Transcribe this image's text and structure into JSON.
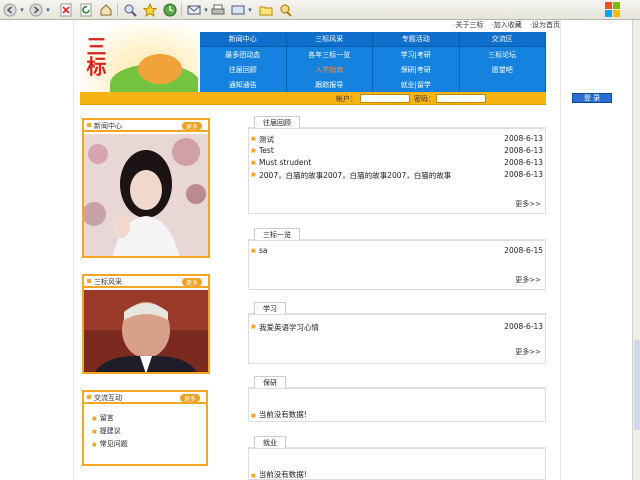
{
  "toolbar": {
    "buttons": [
      "back-icon",
      "forward-icon",
      "stop-icon",
      "refresh-icon",
      "home-icon",
      "search-icon",
      "favorites-icon",
      "history-icon",
      "mail-icon",
      "print-icon",
      "edit-icon",
      "folder-icon",
      "messenger-icon"
    ]
  },
  "top_links": [
    "关于三标",
    "加入收藏",
    "设为首页"
  ],
  "logo": {
    "text": "三标"
  },
  "nav": [
    [
      "新闻中心",
      "三标风采",
      "专题活动",
      "交流区"
    ],
    [
      "最多团动态",
      "各年三标一览",
      "学习|考研",
      "三标论坛"
    ],
    [
      "往届回顾",
      "入学指南",
      "保研|考研",
      "愿望吧"
    ],
    [
      "通知通告",
      "跟踪报导",
      "就业|留学",
      ""
    ]
  ],
  "nav_highlight": "入学指南",
  "login": {
    "account_label": "帐户：",
    "password_label": "密码：",
    "submit": "登 录"
  },
  "sidebar": {
    "news": {
      "title": "新闻中心",
      "more": "更多"
    },
    "style": {
      "title": "三标风采",
      "more": "更多"
    },
    "exchange": {
      "title": "交流互动",
      "more": "更多",
      "items": [
        "留言",
        "提建议",
        "常见问题"
      ]
    }
  },
  "panels": {
    "review": {
      "tab": "往届回顾",
      "rows": [
        {
          "title": "测试",
          "date": "2008-6-13"
        },
        {
          "title": "Test",
          "date": "2008-6-13"
        },
        {
          "title": "Must strudent",
          "date": "2008-6-13"
        },
        {
          "title": "2007，白猫的故事2007，白猫的故事2007，白猫的故事",
          "date": "2008-6-13"
        }
      ],
      "more": "更多>>"
    },
    "overview": {
      "tab": "三标一览",
      "rows": [
        {
          "title": "sa",
          "date": "2008-6-15"
        }
      ],
      "more": "更多>>"
    },
    "study": {
      "tab": "学习",
      "rows": [
        {
          "title": "我爱英语学习心情",
          "date": "2008-6-13"
        }
      ],
      "more": "更多>>"
    },
    "postgrad": {
      "tab": "保研",
      "empty": "当前没有数据!"
    },
    "career": {
      "tab": "就业",
      "empty": "当前没有数据!"
    }
  },
  "colors": {
    "nav_blue": "#1582e0",
    "accent_orange": "#f5a623",
    "login_yellow": "#f5b414"
  }
}
